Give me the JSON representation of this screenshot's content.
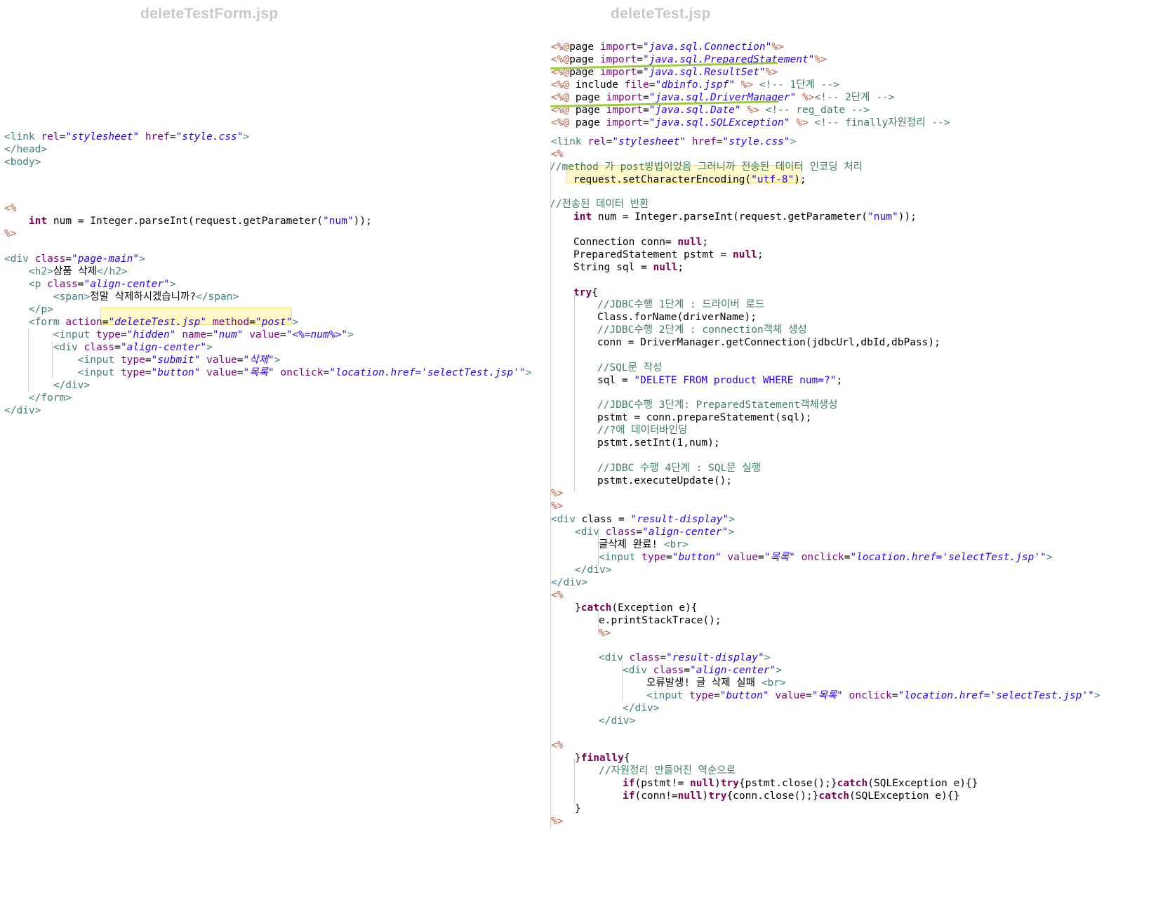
{
  "left": {
    "title": "deleteTestForm.jsp",
    "lines": {
      "l1": "<link rel=\"stylesheet\" href=\"style.css\">",
      "l2": "</head>",
      "l3": "<body>",
      "l4": "<%",
      "l5": "    int num = Integer.parseInt(request.getParameter(\"num\"));",
      "l6": "%>",
      "l7": "<div class=\"page-main\">",
      "l8": "    <h2>상품 삭제</h2>",
      "l9": "    <p class=\"align-center\">",
      "l10": "        <span>정말 삭제하시겠습니까?</span>",
      "l11": "    </p>",
      "l12": "    <form action=\"deleteTest.jsp\" method=\"post\">",
      "l13": "        <input type=\"hidden\" name=\"num\" value=\"<%=num%>\">",
      "l14": "        <div class=\"align-center\">",
      "l15": "            <input type=\"submit\" value=\"삭제\">",
      "l16": "            <input type=\"button\" value=\"목록\" onclick=\"location.href='selectTest.jsp'\">",
      "l17": "        </div>",
      "l18": "    </form>",
      "l19": "</div>"
    }
  },
  "right": {
    "title": "deleteTest.jsp",
    "lines": {
      "r1": "<%@page import=\"java.sql.Connection\"%>",
      "r2": "<%@page import=\"java.sql.PreparedStatement\"%>",
      "r3": "<%@page import=\"java.sql.ResultSet\"%>",
      "r4": "<%@ include file=\"dbinfo.jspf\" %> <!-- 1단계 -->",
      "r5": "<%@ page import=\"java.sql.DriverManager\" %><!-- 2단계 -->",
      "r6": "<%@ page import=\"java.sql.Date\" %> <!-- reg_date -->",
      "r7": "<%@ page import=\"java.sql.SQLException\" %> <!-- finally자원정리 -->",
      "r8": "<link rel=\"stylesheet\" href=\"style.css\">",
      "r9": "<%",
      "r10": "//method 가 post방법이었음 그러니까 전송된 데이터 인코딩 처리",
      "r11": "    request.setCharacterEncoding(\"utf-8\");",
      "r12": "//전송된 데이터 반환",
      "r13": "    int num = Integer.parseInt(request.getParameter(\"num\"));",
      "r14": "    Connection conn= null;",
      "r15": "    PreparedStatement pstmt = null;",
      "r16": "    String sql = null;",
      "r17": "    try{",
      "r18": "        //JDBC수행 1단계 : 드라이버 로드",
      "r19": "        Class.forName(driverName);",
      "r20": "        //JDBC수행 2단계 : connection객체 생성",
      "r21": "        conn = DriverManager.getConnection(jdbcUrl,dbId,dbPass);",
      "r22": "        //SQL문 작성",
      "r23": "        sql = \"DELETE FROM product WHERE num=?\";",
      "r24": "        //JDBC수행 3단계: PreparedStatement객체생성",
      "r25": "        pstmt = conn.prepareStatement(sql);",
      "r26": "        //?에 데이터바인딩",
      "r27": "        pstmt.setInt(1,num);",
      "r28": "        //JDBC 수행 4단계 : SQL문 실행",
      "r29": "        pstmt.executeUpdate();",
      "r30": "%>",
      "r31": "%>",
      "r32": "<div class = \"result-display\">",
      "r33": "    <div class=\"align-center\">",
      "r34": "        글삭제 완료! <br>",
      "r35": "        <input type=\"button\" value=\"목록\" onclick=\"location.href='selectTest.jsp'\">",
      "r36": "    </div>",
      "r37": "</div>",
      "r38": "<%",
      "r39": "    }catch(Exception e){",
      "r40": "        e.printStackTrace();",
      "r41": "        %>",
      "r42": "        <div class=\"result-display\">",
      "r43": "            <div class=\"align-center\">",
      "r44": "                오류발생! 글 삭제 실패 <br>",
      "r45": "                <input type=\"button\" value=\"목록\" onclick=\"location.href='selectTest.jsp'\">",
      "r46": "            </div>",
      "r47": "        </div>",
      "r48": "<%",
      "r49": "    }finally{",
      "r50": "        //자원정리 만들어진 역순으로",
      "r51": "            if(pstmt!= null)try{pstmt.close();}catch(SQLException e){}",
      "r52": "            if(conn!=null)try{conn.close();}catch(SQLException e){}",
      "r53": "    }",
      "r54": "%>"
    }
  },
  "colors": {
    "tag": "#3f7f7f",
    "attribute": "#7f007f",
    "value": "#2a00ff",
    "keyword": "#7f0055",
    "comment": "#3f7f5f",
    "jsp_delimiter": "#bf5f3f",
    "highlight": "#fff59d",
    "strike": "#9ccc3c"
  }
}
